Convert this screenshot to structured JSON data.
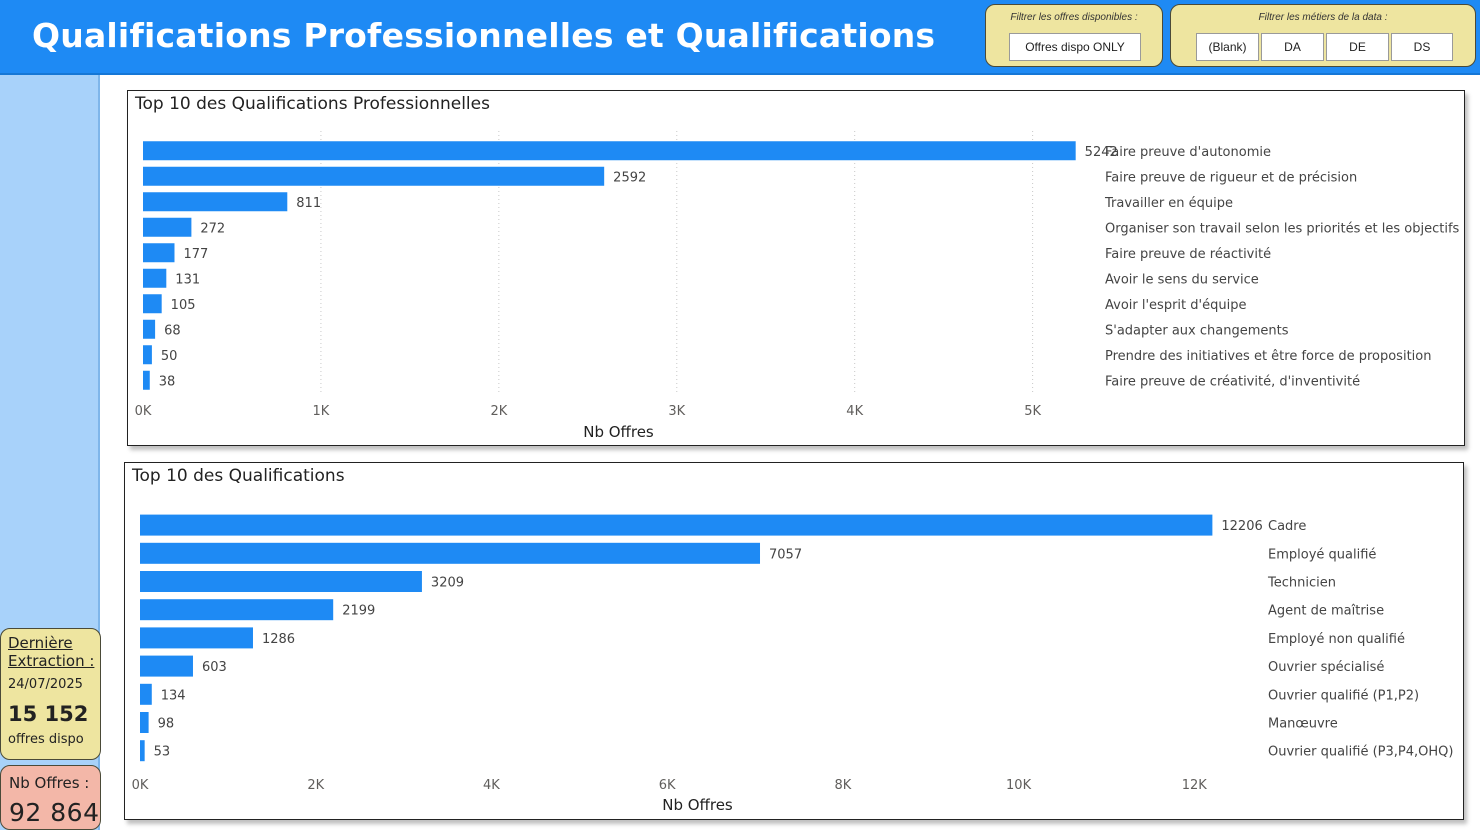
{
  "header": {
    "title": "Qualifications Professionnelles et Qualifications"
  },
  "filters": {
    "dispo": {
      "label": "Filtrer les offres disponibles :",
      "button": "Offres dispo ONLY"
    },
    "metiers": {
      "label": "Filtrer les métiers de la data :",
      "buttons": [
        "(Blank)",
        "DA",
        "DE",
        "DS"
      ]
    }
  },
  "kpis": {
    "extraction": {
      "label_line1": "Dernière",
      "label_line2": "Extraction :",
      "date": "24/07/2025",
      "value": "15 152",
      "sublabel": "offres dispo"
    },
    "nb_offres": {
      "label": "Nb Offres :",
      "value": "92 864"
    }
  },
  "colors": {
    "bar": "#1e8af4",
    "header": "#1e8af4",
    "sidebar": "#a8d2fa",
    "filter_bg": "#eee5a0",
    "kpi_offres_bg": "#f3b7a8"
  },
  "chart_data": [
    {
      "type": "bar",
      "orientation": "horizontal",
      "title": "Top 10 des Qualifications Professionnelles",
      "xlabel": "Nb Offres",
      "ylabel": "",
      "xlim": [
        0,
        5300
      ],
      "xticks": [
        0,
        1000,
        2000,
        3000,
        4000,
        5000
      ],
      "xtick_labels": [
        "0K",
        "1K",
        "2K",
        "3K",
        "4K",
        "5K"
      ],
      "grid": true,
      "categories": [
        "Faire preuve d'autonomie",
        "Faire preuve de rigueur et de précision",
        "Travailler en équipe",
        "Organiser son travail selon les priorités et les objectifs",
        "Faire preuve de réactivité",
        "Avoir le sens du service",
        "Avoir l'esprit d'équipe",
        "S'adapter aux changements",
        "Prendre des initiatives et être force de proposition",
        "Faire preuve de créativité, d'inventivité"
      ],
      "values": [
        5242,
        2592,
        811,
        272,
        177,
        131,
        105,
        68,
        50,
        38
      ]
    },
    {
      "type": "bar",
      "orientation": "horizontal",
      "title": "Top 10 des Qualifications",
      "xlabel": "Nb Offres",
      "ylabel": "",
      "xlim": [
        0,
        12600
      ],
      "xticks": [
        0,
        2000,
        4000,
        6000,
        8000,
        10000,
        12000
      ],
      "xtick_labels": [
        "0K",
        "2K",
        "4K",
        "6K",
        "8K",
        "10K",
        "12K"
      ],
      "grid": false,
      "categories": [
        "Cadre",
        "Employé qualifié",
        "Technicien",
        "Agent de maîtrise",
        "Employé non qualifié",
        "Ouvrier spécialisé",
        "Ouvrier qualifié (P1,P2)",
        "Manœuvre",
        "Ouvrier qualifié (P3,P4,OHQ)"
      ],
      "values": [
        12206,
        7057,
        3209,
        2199,
        1286,
        603,
        134,
        98,
        53
      ]
    }
  ]
}
